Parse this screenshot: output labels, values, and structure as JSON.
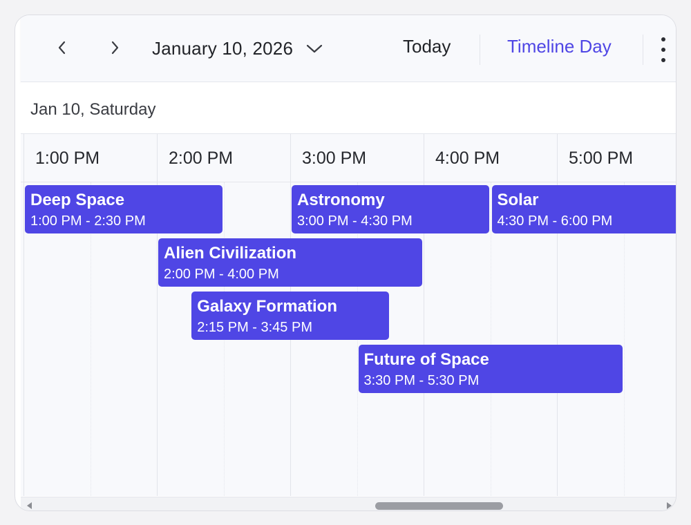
{
  "toolbar": {
    "prev_icon": "chevron-left-icon",
    "next_icon": "chevron-right-icon",
    "date": "January 10, 2026",
    "date_dropdown_icon": "chevron-down-icon",
    "today_label": "Today",
    "view_label": "Timeline Day",
    "more_icon": "more-vertical-icon"
  },
  "day_header": {
    "label": "Jan 10, Saturday"
  },
  "time_slots": [
    "1:00 PM",
    "2:00 PM",
    "3:00 PM",
    "4:00 PM",
    "5:00 PM"
  ],
  "events": [
    {
      "title": "Deep Space",
      "time": "1:00 PM - 2:30 PM",
      "start": "13:00",
      "end": "14:30"
    },
    {
      "title": "Astronomy",
      "time": "3:00 PM - 4:30 PM",
      "start": "15:00",
      "end": "16:30"
    },
    {
      "title": "Solar",
      "time": "4:30 PM - 6:00 PM",
      "start": "16:30",
      "end": "18:00"
    },
    {
      "title": "Alien Civilization",
      "time": "2:00 PM - 4:00 PM",
      "start": "14:00",
      "end": "16:00"
    },
    {
      "title": "Galaxy Formation",
      "time": "2:15 PM - 3:45 PM",
      "start": "14:15",
      "end": "15:45"
    },
    {
      "title": "Future of Space",
      "time": "3:30 PM - 5:30 PM",
      "start": "15:30",
      "end": "17:30"
    }
  ],
  "colors": {
    "accent": "#4f46e5",
    "event_bg": "#4f46e5",
    "event_text": "#ffffff"
  }
}
